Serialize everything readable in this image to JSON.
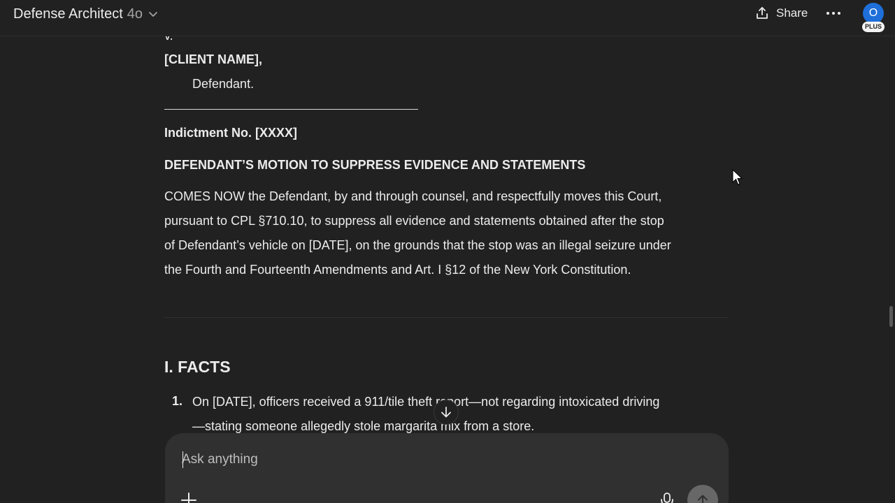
{
  "header": {
    "model_name": "Defense Architect",
    "model_version": "4o",
    "share_label": "Share",
    "avatar_initial": "O",
    "plan_badge": "PLUS"
  },
  "document": {
    "v_line": "v.",
    "client_name": "[CLIENT NAME],",
    "defendant_label": "Defendant.",
    "indictment": "Indictment No. [XXXX]",
    "motion_title": "DEFENDANT’S MOTION TO SUPPRESS EVIDENCE AND STATEMENTS",
    "intro_lines": [
      "COMES NOW the Defendant, by and through counsel, and respectfully moves this Court,",
      "pursuant to CPL §710.10, to suppress all evidence and statements obtained after the stop",
      "of Defendant’s vehicle on [DATE], on the grounds that the stop was an illegal seizure under",
      "the Fourth and Fourteenth Amendments and Art. I §12 of the New York Constitution."
    ],
    "facts_heading": "I. FACTS",
    "facts": [
      {
        "number": "1.",
        "lines": [
          "On [DATE], officers received a 911/tile theft report—not regarding intoxicated driving",
          "—stating someone allegedly stole margarita mix from a store."
        ]
      }
    ]
  },
  "composer": {
    "placeholder": "Ask anything"
  },
  "colors": {
    "background": "#212121",
    "composer": "#303030",
    "avatar": "#1e6fd9",
    "text": "#ececec"
  }
}
